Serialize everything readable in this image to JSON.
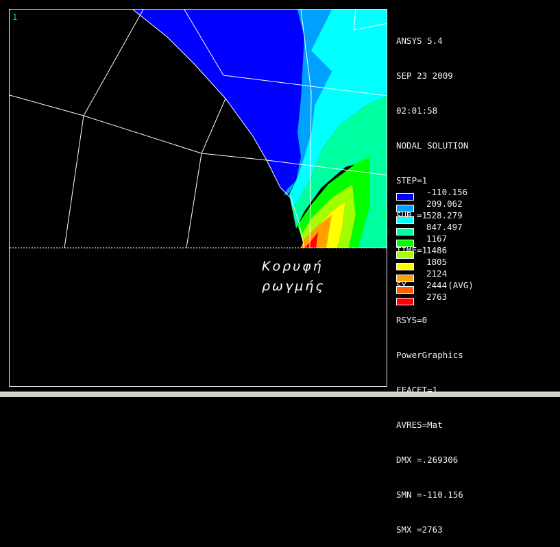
{
  "window_number": "1",
  "info": [
    "ANSYS 5.4",
    "SEP 23 2009",
    "02:01:58",
    "NODAL SOLUTION",
    "STEP=1",
    "SUB =1",
    "TIME=1",
    "SY        (AVG)",
    "RSYS=0",
    "PowerGraphics",
    "EFACET=1",
    "AVRES=Mat",
    "DMX =.269306",
    "SMN =-110.156",
    "SMX =2763"
  ],
  "legend": [
    {
      "value": "-110.156",
      "color": "#0000ff"
    },
    {
      "value": "209.062",
      "color": "#00a0ff"
    },
    {
      "value": "528.279",
      "color": "#00ffff"
    },
    {
      "value": "847.497",
      "color": "#00ffa0"
    },
    {
      "value": "1167",
      "color": "#00ff00"
    },
    {
      "value": "1486",
      "color": "#a0ff00"
    },
    {
      "value": "1805",
      "color": "#ffff00"
    },
    {
      "value": "2124",
      "color": "#ffa000"
    },
    {
      "value": "2444",
      "color": "#ff6000"
    },
    {
      "value": "2763",
      "color": "#ff0000"
    }
  ],
  "annotation": {
    "line1": "Κορυφή",
    "line2": "ρωγμής"
  },
  "colors": {
    "background": "#000000",
    "mesh_line": "#ffffff",
    "frame": "#e8e8e8",
    "window_number": "#00c8c8"
  }
}
